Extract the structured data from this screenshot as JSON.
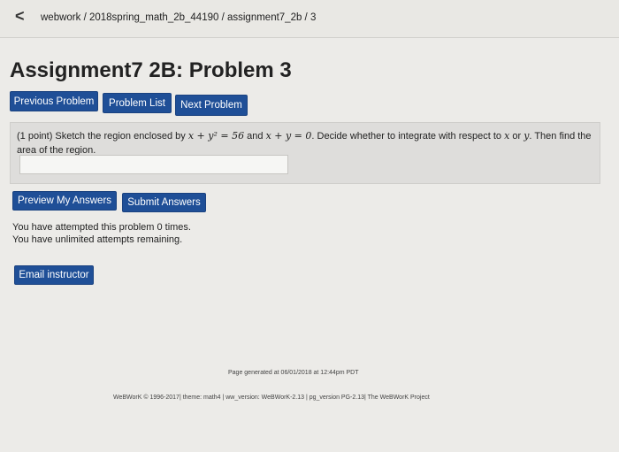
{
  "browser": {
    "back_glyph": "<",
    "breadcrumb": "webwork / 2018spring_math_2b_44190 / assignment7_2b / 3"
  },
  "page": {
    "title": "Assignment7 2B: Problem 3"
  },
  "nav": {
    "previous": "Previous Problem",
    "list": "Problem List",
    "next": "Next Problem"
  },
  "problem": {
    "points": "(1 point) Sketch the region enclosed by ",
    "eq1": "x + y² = 56",
    "and": " and ",
    "eq2": "x + y = 0",
    "rest": ". Decide whether to integrate with respect to ",
    "var_x": "x",
    "or": " or ",
    "var_y": "y",
    "rest2": ". Then find the area of the region.",
    "answer_value": ""
  },
  "actions": {
    "preview": "Preview My Answers",
    "submit": "Submit Answers"
  },
  "status": {
    "attempted": "You have attempted this problem 0 times.",
    "remaining": "You have unlimited attempts remaining."
  },
  "email": {
    "label": "Email instructor"
  },
  "footer": {
    "generated": "Page generated at 06/01/2018 at 12:44pm PDT",
    "credits": "WeBWorK © 1996-2017| theme: math4 | ww_version: WeBWorK-2.13 | pg_version PG-2.13| The WeBWorK Project"
  },
  "colors": {
    "button_blue": "#1f4f97",
    "page_bg": "#ecebe8",
    "problem_bg": "#dedddb"
  }
}
